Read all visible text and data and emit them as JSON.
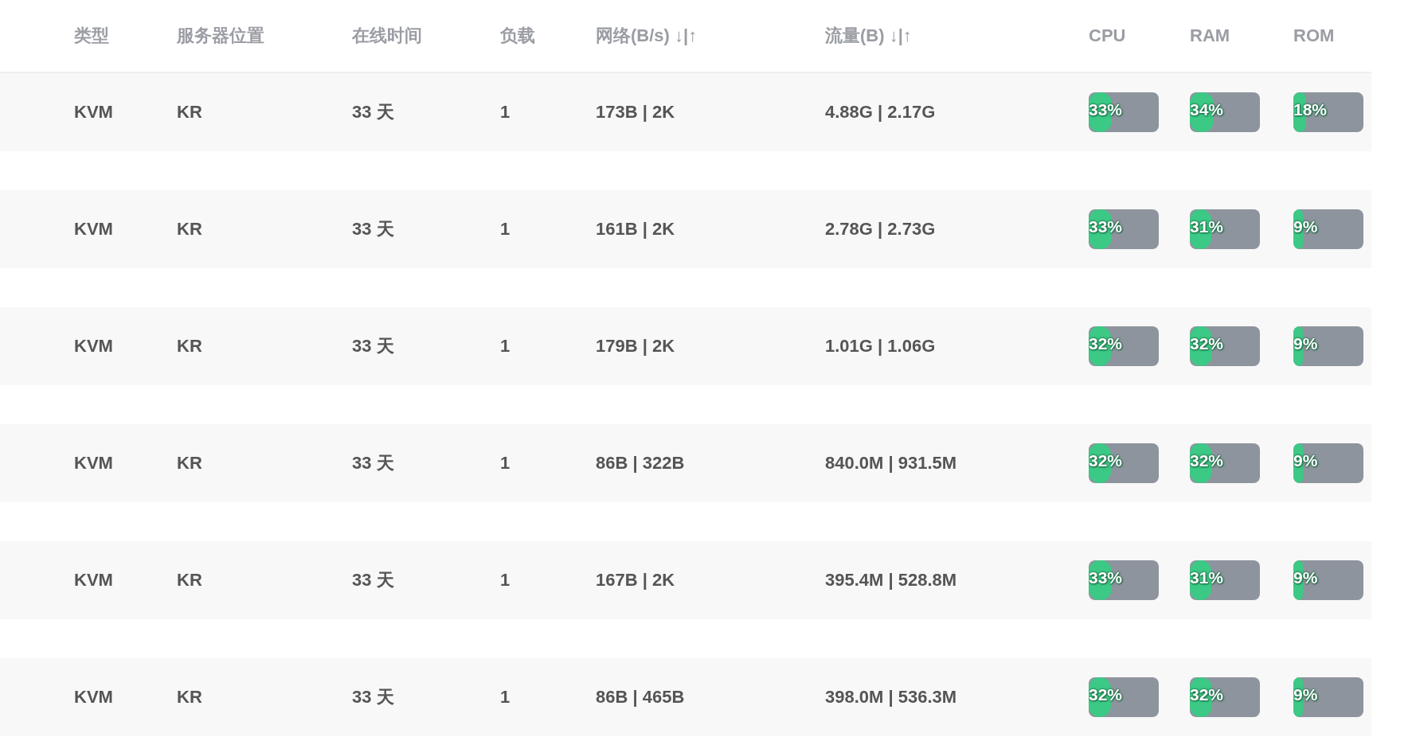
{
  "table": {
    "columns": [
      "类型",
      "服务器位置",
      "在线时间",
      "负载",
      "网络(B/s) ↓|↑",
      "流量(B) ↓|↑",
      "CPU",
      "RAM",
      "ROM"
    ],
    "rows": [
      {
        "type": "KVM",
        "location": "KR",
        "uptime": "33 天",
        "load": "1",
        "network": "173B | 2K",
        "traffic": "4.88G | 2.17G",
        "cpu": {
          "text": "33%",
          "level": 0.33
        },
        "ram": {
          "text": "34%",
          "level": 0.34
        },
        "rom": {
          "text": "18%",
          "level": 0.18
        }
      },
      {
        "type": "KVM",
        "location": "KR",
        "uptime": "33 天",
        "load": "1",
        "network": "161B | 2K",
        "traffic": "2.78G | 2.73G",
        "cpu": {
          "text": "33%",
          "level": 0.33
        },
        "ram": {
          "text": "31%",
          "level": 0.31
        },
        "rom": {
          "text": "9%",
          "level": 0.09
        }
      },
      {
        "type": "KVM",
        "location": "KR",
        "uptime": "33 天",
        "load": "1",
        "network": "179B | 2K",
        "traffic": "1.01G | 1.06G",
        "cpu": {
          "text": "32%",
          "level": 0.32
        },
        "ram": {
          "text": "32%",
          "level": 0.32
        },
        "rom": {
          "text": "9%",
          "level": 0.09
        }
      },
      {
        "type": "KVM",
        "location": "KR",
        "uptime": "33 天",
        "load": "1",
        "network": "86B | 322B",
        "traffic": "840.0M | 931.5M",
        "cpu": {
          "text": "32%",
          "level": 0.32
        },
        "ram": {
          "text": "32%",
          "level": 0.32
        },
        "rom": {
          "text": "9%",
          "level": 0.09
        }
      },
      {
        "type": "KVM",
        "location": "KR",
        "uptime": "33 天",
        "load": "1",
        "network": "167B | 2K",
        "traffic": "395.4M | 528.8M",
        "cpu": {
          "text": "33%",
          "level": 0.33
        },
        "ram": {
          "text": "31%",
          "level": 0.31
        },
        "rom": {
          "text": "9%",
          "level": 0.09
        }
      },
      {
        "type": "KVM",
        "location": "KR",
        "uptime": "33 天",
        "load": "1",
        "network": "86B | 465B",
        "traffic": "398.0M | 536.3M",
        "cpu": {
          "text": "32%",
          "level": 0.32
        },
        "ram": {
          "text": "32%",
          "level": 0.32
        },
        "rom": {
          "text": "9%",
          "level": 0.09
        }
      }
    ]
  }
}
